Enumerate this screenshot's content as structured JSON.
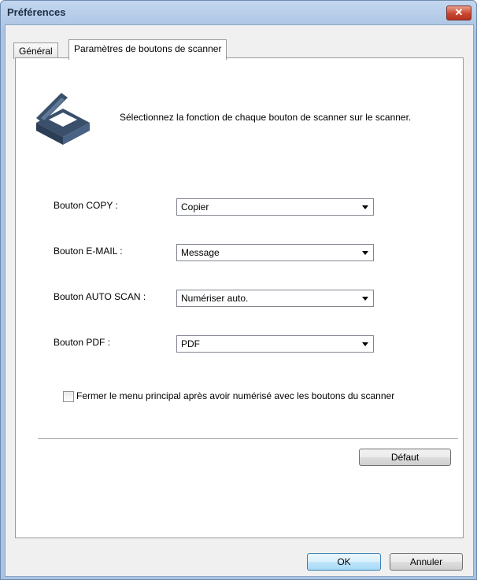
{
  "window": {
    "title": "Préférences",
    "close_symbol": "✕"
  },
  "tabs": [
    {
      "label": "Général",
      "active": false
    },
    {
      "label": "Paramètres de boutons de scanner",
      "active": true
    }
  ],
  "panel": {
    "icon": "scanner-icon",
    "description": "Sélectionnez la fonction de chaque bouton de scanner sur le scanner.",
    "rows": [
      {
        "label": "Bouton COPY :",
        "value": "Copier"
      },
      {
        "label": "Bouton E-MAIL :",
        "value": "Message"
      },
      {
        "label": "Bouton AUTO SCAN :",
        "value": "Numériser auto."
      },
      {
        "label": "Bouton PDF :",
        "value": "PDF"
      }
    ],
    "checkbox": {
      "label": "Fermer le menu principal après avoir numérisé avec les boutons du scanner",
      "checked": false
    },
    "default_button": "Défaut"
  },
  "footer": {
    "ok": "OK",
    "cancel": "Annuler"
  }
}
